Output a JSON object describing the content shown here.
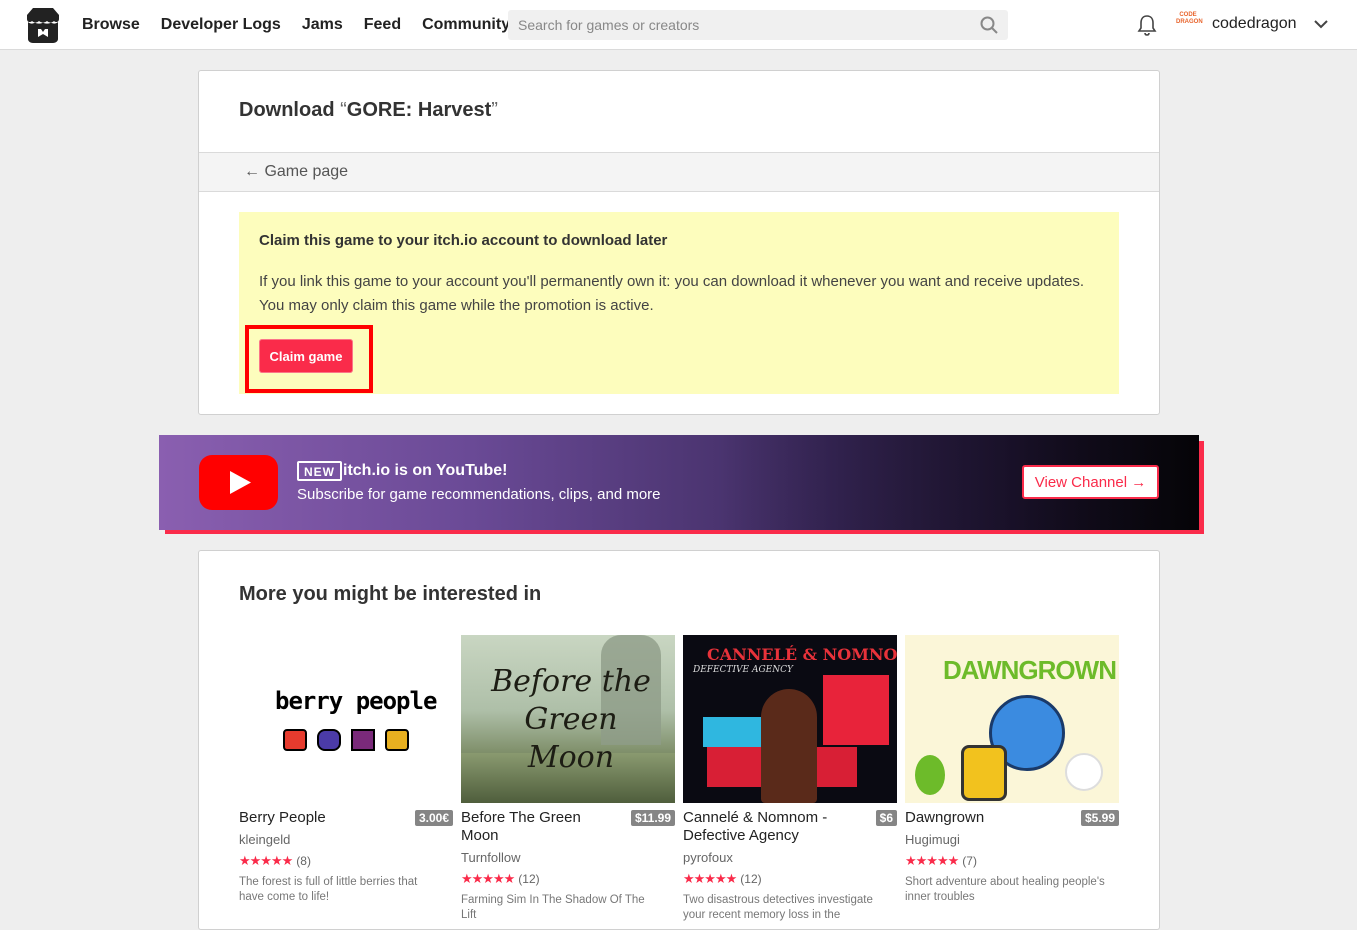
{
  "header": {
    "nav": [
      "Browse",
      "Developer Logs",
      "Jams",
      "Feed",
      "Community"
    ],
    "search_placeholder": "Search for games or creators",
    "avatar_text": "CODE DRAGON",
    "username": "codedragon"
  },
  "download": {
    "title_prefix": "Download",
    "open_quote": "“",
    "game_name": "GORE: Harvest",
    "close_quote": "”",
    "back_label": "← Game page",
    "claim_heading": "Claim this game to your itch.io account to download later",
    "claim_text": "If you link this game to your account you'll permanently own it: you can download it whenever you want and receive updates. You may only claim this game while the promotion is active.",
    "claim_button": "Claim game"
  },
  "youtube": {
    "badge": "NEW",
    "title": "itch.io is on YouTube!",
    "subtitle": "Subscribe for game recommendations, clips, and more",
    "button": "View Channel →"
  },
  "recommendations": {
    "heading": "More you might be interested in",
    "games": [
      {
        "title": "Berry People",
        "price": "3.00€",
        "author": "kleingeld",
        "stars": "★★★★★",
        "count": "(8)",
        "desc": "The forest is full of little berries that have come to life!",
        "thumb_text": "berry people"
      },
      {
        "title": "Before The Green Moon",
        "price": "$11.99",
        "author": "Turnfollow",
        "stars": "★★★★★",
        "count": "(12)",
        "desc": "Farming Sim In The Shadow Of The Lift",
        "thumb_text": "Before the Green Moon"
      },
      {
        "title": "Cannelé & Nomnom - Defective Agency",
        "price": "$6",
        "author": "pyrofoux",
        "stars": "★★★★★",
        "count": "(12)",
        "desc": "Two disastrous detectives investigate your recent memory loss in the",
        "thumb_text": "CANNELÉ & NOMNOM",
        "thumb_sub": "DEFECTIVE AGENCY"
      },
      {
        "title": "Dawngrown",
        "price": "$5.99",
        "author": "Hugimugi",
        "stars": "★★★★★",
        "count": "(7)",
        "desc": "Short adventure about healing people's inner troubles",
        "thumb_text": "DAWNGROWN"
      }
    ]
  }
}
